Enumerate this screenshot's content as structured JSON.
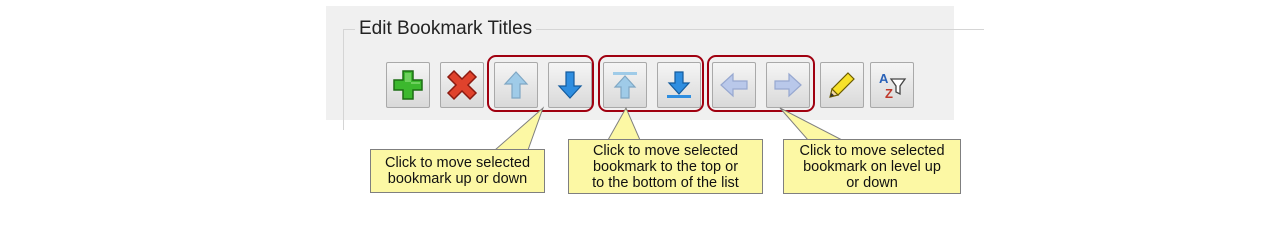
{
  "group": {
    "title": "Edit Bookmark Titles"
  },
  "toolbar": {
    "buttons": [
      {
        "name": "add-bookmark-button",
        "icon": "green-plus-icon"
      },
      {
        "name": "delete-bookmark-button",
        "icon": "red-x-icon"
      },
      {
        "name": "move-up-button",
        "icon": "arrow-up-icon",
        "disabled": true
      },
      {
        "name": "move-down-button",
        "icon": "arrow-down-icon"
      },
      {
        "name": "move-to-top-button",
        "icon": "arrow-to-top-icon",
        "disabled": true
      },
      {
        "name": "move-to-bottom-button",
        "icon": "arrow-to-bottom-icon"
      },
      {
        "name": "level-up-button",
        "icon": "arrow-left-icon",
        "disabled": true
      },
      {
        "name": "level-down-button",
        "icon": "arrow-right-icon",
        "disabled": true
      },
      {
        "name": "edit-title-button",
        "icon": "pencil-icon"
      },
      {
        "name": "sort-filter-button",
        "icon": "az-filter-icon"
      }
    ]
  },
  "callouts": {
    "up_down": [
      "Click to move selected",
      "bookmark up or down"
    ],
    "top_bottom": [
      "Click to move selected",
      "bookmark to the top or",
      "to the bottom of the list"
    ],
    "level": [
      "Click to move selected",
      "bookmark on level up",
      "or down"
    ]
  },
  "colors": {
    "highlight_border": "#a00010",
    "callout_fill": "#fcf8a4",
    "panel_bg": "#f0f0f0"
  }
}
